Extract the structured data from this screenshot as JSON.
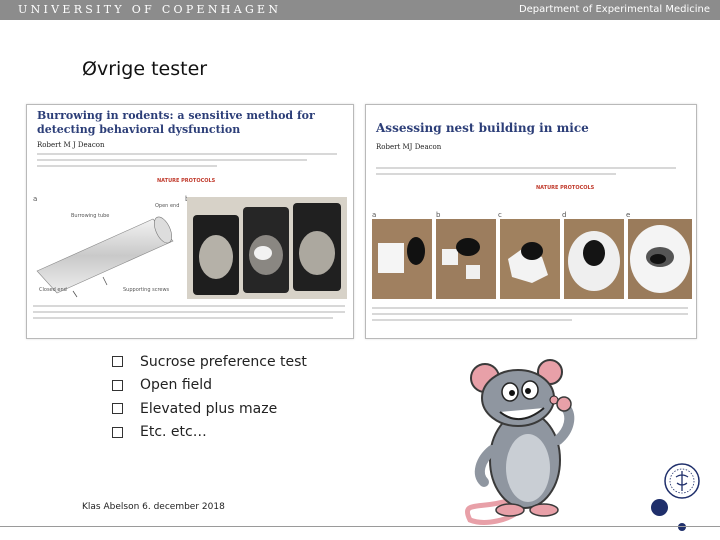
{
  "header": {
    "university": "UNIVERSITY OF COPENHAGEN",
    "department": "Department of Experimental Medicine"
  },
  "slide": {
    "title": "Øvrige tester",
    "bullets": [
      "Sucrose preference test",
      "Open field",
      "Elevated plus maze",
      "Etc. etc…"
    ]
  },
  "papers": [
    {
      "title": "Burrowing in rodents: a sensitive method for detecting behavioral dysfunction",
      "author": "Robert M J Deacon",
      "panel_labels": [
        "a",
        "b"
      ],
      "annotations": [
        "Open end",
        "Burrowing tube",
        "Closed end",
        "Supporting screws"
      ],
      "journal": "NATURE PROTOCOLS"
    },
    {
      "title": "Assessing nest building in mice",
      "author": "Robert MJ Deacon",
      "panel_labels": [
        "a",
        "b",
        "c",
        "d",
        "e"
      ],
      "journal": "NATURE PROTOCOLS"
    }
  ],
  "footer": {
    "text": "Klas Abelson 6. december 2018"
  },
  "colors": {
    "topbar": "#8c8c8c",
    "title_blue": "#2c3e78",
    "dot": "#1f2f6b"
  }
}
